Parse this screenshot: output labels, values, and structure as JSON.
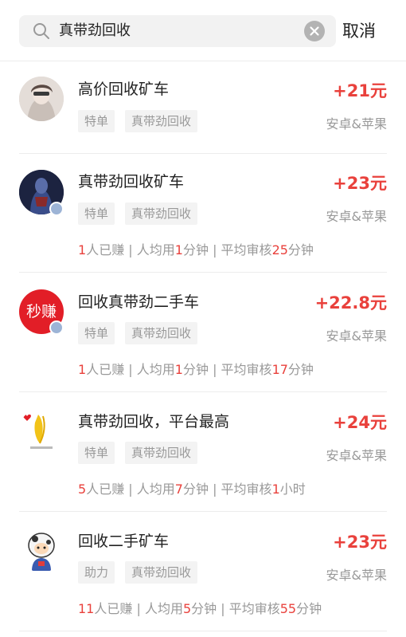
{
  "search": {
    "query": "真带劲回收",
    "cancel_label": "取消"
  },
  "items": [
    {
      "title": "高价回收矿车",
      "price": "+21元",
      "tags": [
        "特单",
        "真带劲回收"
      ],
      "platform": "安卓&苹果"
    },
    {
      "title": "真带劲回收矿车",
      "price": "+23元",
      "tags": [
        "特单",
        "真带劲回收"
      ],
      "platform": "安卓&苹果",
      "stats": {
        "earned": "1",
        "earned_label": "人已赚",
        "sep1": " | ",
        "avg_prefix": "人均用",
        "avg": "1",
        "avg_unit": "分钟",
        "sep2": " | ",
        "review_prefix": "平均审核",
        "review": "25",
        "review_unit": "分钟"
      }
    },
    {
      "title": "回收真带劲二手车",
      "price": "+22.8元",
      "tags": [
        "特单",
        "真带劲回收"
      ],
      "platform": "安卓&苹果",
      "avatar_text": "秒赚",
      "stats": {
        "earned": "1",
        "earned_label": "人已赚",
        "sep1": " | ",
        "avg_prefix": "人均用",
        "avg": "1",
        "avg_unit": "分钟",
        "sep2": " | ",
        "review_prefix": "平均审核",
        "review": "17",
        "review_unit": "分钟"
      }
    },
    {
      "title": "真带劲回收，平台最高",
      "price": "+24元",
      "tags": [
        "特单",
        "真带劲回收"
      ],
      "platform": "安卓&苹果",
      "stats": {
        "earned": "5",
        "earned_label": "人已赚",
        "sep1": " | ",
        "avg_prefix": "人均用",
        "avg": "7",
        "avg_unit": "分钟",
        "sep2": " | ",
        "review_prefix": "平均审核",
        "review": "1",
        "review_unit": "小时"
      }
    },
    {
      "title": "回收二手矿车",
      "price": "+23元",
      "tags": [
        "助力",
        "真带劲回收"
      ],
      "platform": "安卓&苹果",
      "stats": {
        "earned": "11",
        "earned_label": "人已赚",
        "sep1": " | ",
        "avg_prefix": "人均用",
        "avg": "5",
        "avg_unit": "分钟",
        "sep2": " | ",
        "review_prefix": "平均审核",
        "review": "55",
        "review_unit": "分钟"
      }
    }
  ],
  "colors": {
    "accent": "#e9413c",
    "muted": "#999999",
    "tag_bg": "#f3f3f3"
  }
}
